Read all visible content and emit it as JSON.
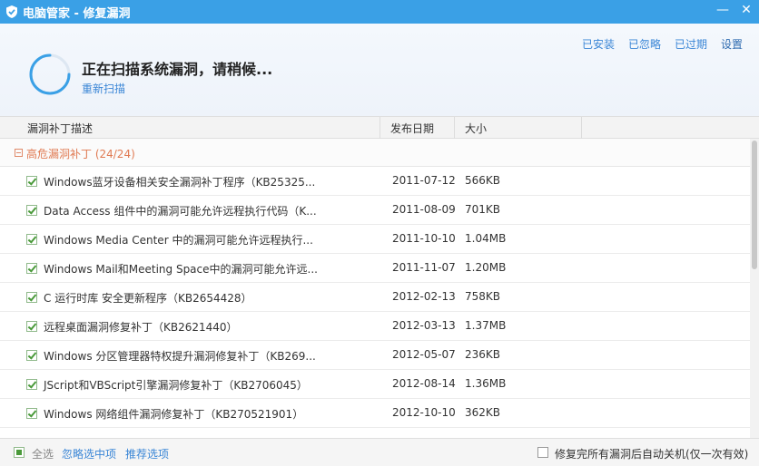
{
  "window": {
    "app_name": "电脑管家",
    "separator": " - ",
    "module": "修复漏洞",
    "minimize": "—",
    "close": "✕"
  },
  "header": {
    "status": "正在扫描系统漏洞，请稍候...",
    "rescan": "重新扫描",
    "links": {
      "installed": "已安装",
      "ignored": "已忽略",
      "expired": "已过期",
      "settings": "设置"
    }
  },
  "columns": {
    "desc": "漏洞补丁描述",
    "date": "发布日期",
    "size": "大小"
  },
  "group": {
    "title": "高危漏洞补丁 (24/24)"
  },
  "patches": [
    {
      "desc": "Windows蓝牙设备相关安全漏洞补丁程序（KB25325...",
      "date": "2011-07-12",
      "size": "566KB"
    },
    {
      "desc": "Data Access 组件中的漏洞可能允许远程执行代码（K...",
      "date": "2011-08-09",
      "size": "701KB"
    },
    {
      "desc": "Windows Media Center 中的漏洞可能允许远程执行...",
      "date": "2011-10-10",
      "size": "1.04MB"
    },
    {
      "desc": "Windows Mail和Meeting Space中的漏洞可能允许远...",
      "date": "2011-11-07",
      "size": "1.20MB"
    },
    {
      "desc": "C 运行时库 安全更新程序（KB2654428）",
      "date": "2012-02-13",
      "size": "758KB"
    },
    {
      "desc": "远程桌面漏洞修复补丁（KB2621440）",
      "date": "2012-03-13",
      "size": "1.37MB"
    },
    {
      "desc": "Windows 分区管理器特权提升漏洞修复补丁（KB269...",
      "date": "2012-05-07",
      "size": "236KB"
    },
    {
      "desc": "JScript和VBScript引擎漏洞修复补丁（KB2706045）",
      "date": "2012-08-14",
      "size": "1.36MB"
    },
    {
      "desc": "Windows 网络组件漏洞修复补丁（KB270521901）",
      "date": "2012-10-10",
      "size": "362KB"
    }
  ],
  "footer": {
    "select_all": "全选",
    "ignore_selected": "忽略选中项",
    "recommended": "推荐选项",
    "auto_shutdown": "修复完所有漏洞后自动关机(仅一次有效)"
  },
  "colors": {
    "titlebar": "#3aa0e6",
    "link": "#3a86d6",
    "group_title": "#e07a52",
    "check": "#4a9a3a"
  }
}
